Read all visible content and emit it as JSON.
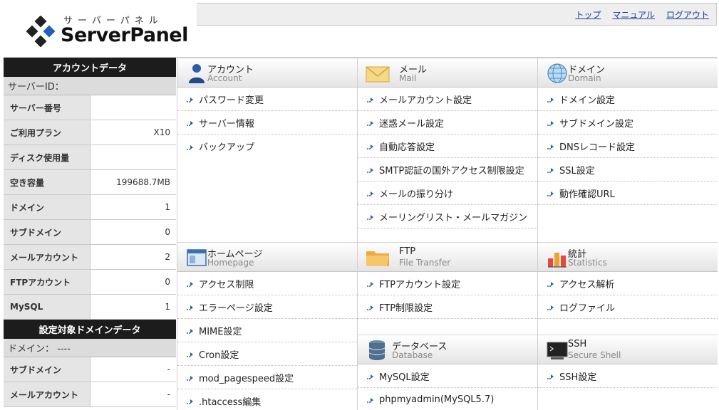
{
  "logo": {
    "kana": "サーバーパネル",
    "name": "ServerPanel"
  },
  "header": {
    "links": [
      "トップ",
      "マニュアル",
      "ログアウト"
    ]
  },
  "sidebar": {
    "account": {
      "title": "アカウントデータ",
      "server_id_label": "サーバーID：",
      "rows": [
        {
          "label": "サーバー番号",
          "value": ""
        },
        {
          "label": "ご利用プラン",
          "value": "X10"
        },
        {
          "label": "ディスク使用量",
          "value": ""
        },
        {
          "label": "空き容量",
          "value": "199688.7MB"
        },
        {
          "label": "ドメイン",
          "value": "1"
        },
        {
          "label": "サブドメイン",
          "value": "0"
        },
        {
          "label": "メールアカウント",
          "value": "2"
        },
        {
          "label": "FTPアカウント",
          "value": "0"
        },
        {
          "label": "MySQL",
          "value": "1"
        }
      ]
    },
    "domain": {
      "title": "設定対象ドメインデータ",
      "domain_label": "ドメイン： ----",
      "rows": [
        {
          "label": "サブドメイン",
          "value": "-"
        },
        {
          "label": "メールアカウント",
          "value": "-"
        }
      ]
    }
  },
  "sections": {
    "account": {
      "title": "アカウント",
      "sub": "Account",
      "items": [
        "パスワード変更",
        "サーバー情報",
        "バックアップ"
      ]
    },
    "mail": {
      "title": "メール",
      "sub": "Mail",
      "items": [
        "メールアカウント設定",
        "迷惑メール設定",
        "自動応答設定",
        "SMTP認証の国外アクセス制限設定",
        "メールの振り分け",
        "メーリングリスト・メールマガジン"
      ]
    },
    "domain": {
      "title": "ドメイン",
      "sub": "Domain",
      "items": [
        "ドメイン設定",
        "サブドメイン設定",
        "DNSレコード設定",
        "SSL設定",
        "動作確認URL"
      ]
    },
    "homepage": {
      "title": "ホームページ",
      "sub": "Homepage",
      "items": [
        "アクセス制限",
        "エラーページ設定",
        "MIME設定",
        "Cron設定",
        "mod_pagespeed設定",
        ".htaccess編集"
      ]
    },
    "ftp": {
      "title": "FTP",
      "sub": "File Transfer",
      "items": [
        "FTPアカウント設定",
        "FTP制限設定"
      ]
    },
    "stats": {
      "title": "統計",
      "sub": "Statistics",
      "items": [
        "アクセス解析",
        "ログファイル"
      ]
    },
    "database": {
      "title": "データベース",
      "sub": "Database",
      "items": [
        "MySQL設定",
        "phpmyadmin(MySQL5.7)"
      ]
    },
    "ssh": {
      "title": "SSH",
      "sub": "Secure Shell",
      "items": [
        "SSH設定"
      ]
    }
  },
  "icons": {
    "account": "person-icon",
    "mail": "envelope-icon",
    "domain": "globe-icon",
    "homepage": "window-icon",
    "ftp": "folder-icon",
    "stats": "chart-icon",
    "database": "database-icon",
    "ssh": "terminal-icon",
    "menu": "arrow-icon"
  },
  "colors": {
    "link": "#1a3f9c",
    "sidebar_title_bg": "#1c1c1c",
    "brand_blue": "#1f5fbf"
  }
}
